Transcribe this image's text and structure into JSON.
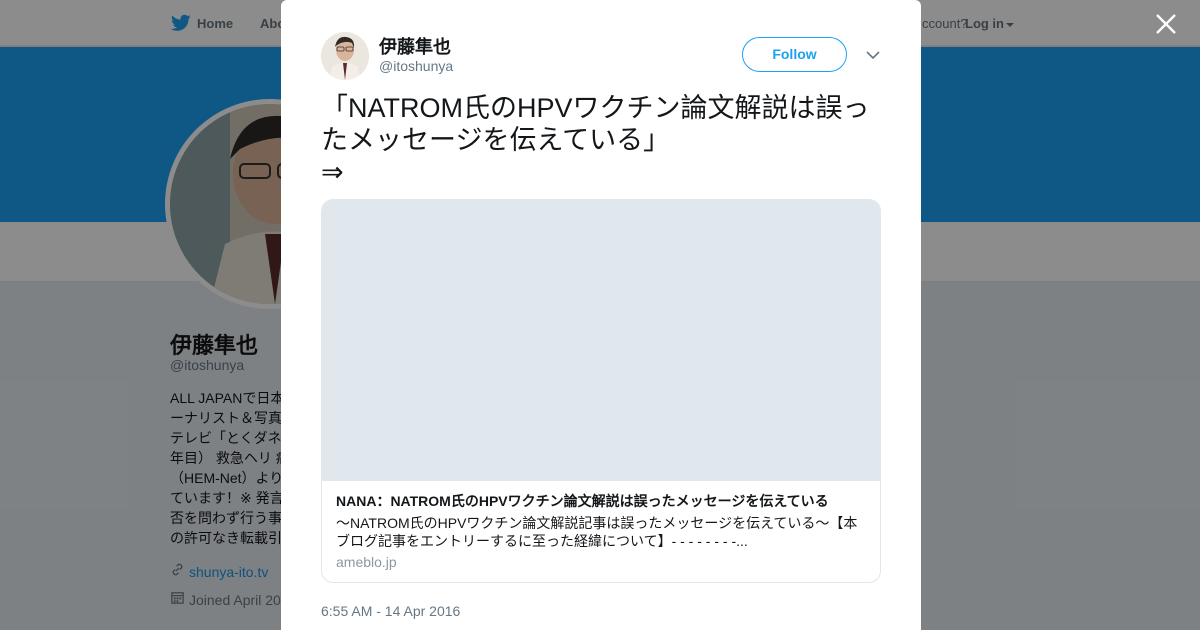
{
  "background": {
    "nav": {
      "home_label": "Home",
      "about_label": "Abo",
      "account_label": "ccount?",
      "login_label": "Log in"
    },
    "profile": {
      "name": "伊藤隼也",
      "handle": "@itoshunya",
      "bio_lines": [
        "ALL JAPANで日本",
        "ーナリスト＆写真",
        "テレビ「とくダネ",
        "年目） 救急ヘリ 病",
        "（HEM-Net）より",
        "ています！※ 発言",
        "否を問わず行う事",
        "の許可なき転載引"
      ],
      "website": "shunya-ito.tv",
      "joined": "Joined April 20"
    }
  },
  "modal": {
    "author": {
      "name": "伊藤隼也",
      "handle": "@itoshunya"
    },
    "follow_label": "Follow",
    "tweet_text": "「NATROM氏のHPVワクチン論文解説は誤ったメッセージを伝えている」\n⇒",
    "card": {
      "title": "NANA：NATROM氏のHPVワクチン論文解説は誤ったメッセージを伝えている",
      "description": "～NATROM氏のHPVワクチン論文解説記事は誤ったメッセージを伝えている～【本ブログ記事をエントリーするに至った経緯について】- - - - - - - -...",
      "domain": "ameblo.jp"
    },
    "timestamp": "6:55 AM - 14 Apr 2016"
  },
  "colors": {
    "accent": "#1da1f2",
    "link": "#1b95e0",
    "text": "#14171a",
    "muted": "#657786"
  },
  "icons": [
    "twitter-bird-icon",
    "chevron-down-icon",
    "link-icon",
    "calendar-icon",
    "close-icon"
  ]
}
